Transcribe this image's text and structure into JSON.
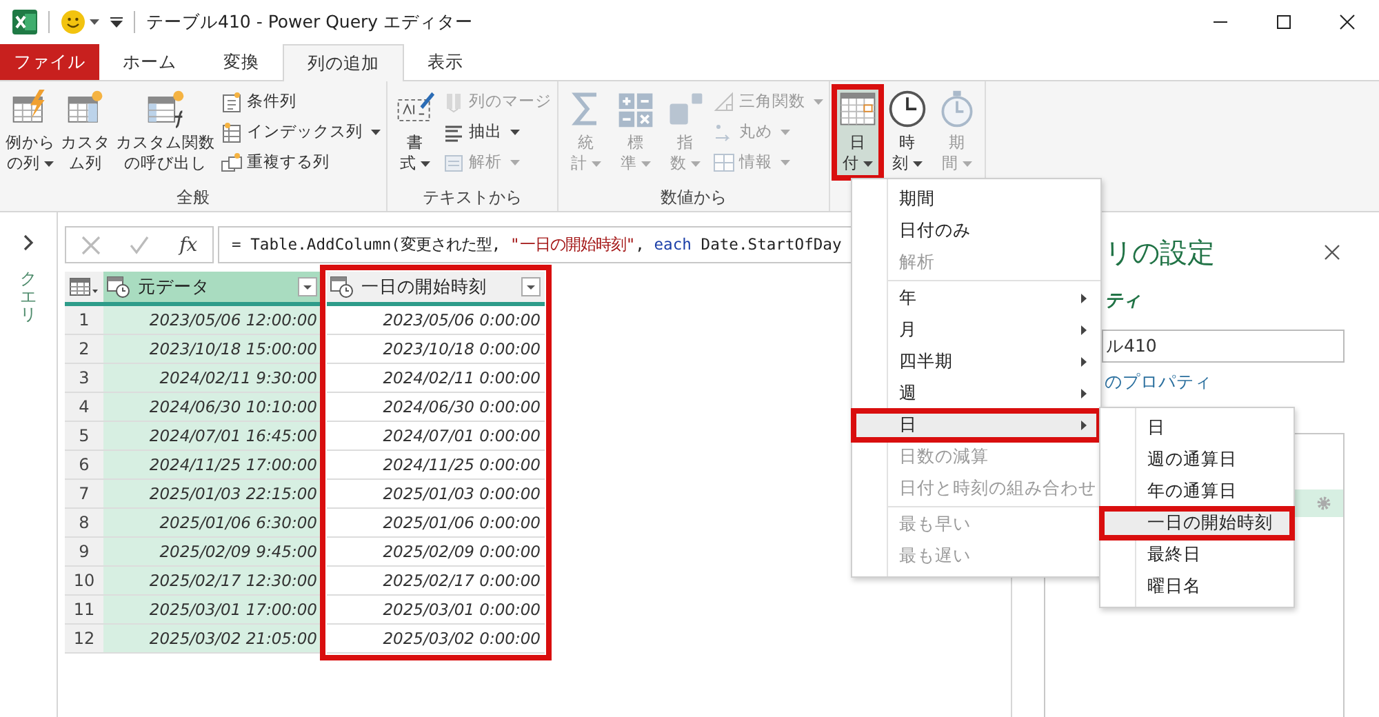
{
  "window": {
    "title": "テーブル410 - Power Query エディター"
  },
  "tabs": [
    {
      "label": "ファイル",
      "kind": "file",
      "selected": false
    },
    {
      "label": "ホーム",
      "kind": "tab",
      "selected": false
    },
    {
      "label": "変換",
      "kind": "tab",
      "selected": false
    },
    {
      "label": "列の追加",
      "kind": "tab",
      "selected": true
    },
    {
      "label": "表示",
      "kind": "tab",
      "selected": false
    }
  ],
  "ribbon": {
    "groups": [
      {
        "label": "全般",
        "items": [
          {
            "kind": "large",
            "lines": [
              "例から",
              "の列"
            ],
            "dropdown": true,
            "disabled": false,
            "highlighted": false
          },
          {
            "kind": "large",
            "lines": [
              "カスタ",
              "ム列"
            ],
            "dropdown": false,
            "disabled": false,
            "highlighted": false
          },
          {
            "kind": "large",
            "lines": [
              "カスタム関数",
              "の呼び出し"
            ],
            "dropdown": false,
            "disabled": false,
            "highlighted": false
          },
          {
            "kind": "stack",
            "entries": [
              {
                "label": "条件列",
                "dropdown": false,
                "disabled": false
              },
              {
                "label": "インデックス列",
                "dropdown": true,
                "disabled": false
              },
              {
                "label": "重複する列",
                "dropdown": false,
                "disabled": false
              }
            ]
          }
        ]
      },
      {
        "label": "テキストから",
        "items": [
          {
            "kind": "large",
            "lines": [
              "書",
              "式"
            ],
            "dropdown": true,
            "disabled": false,
            "highlighted": false
          },
          {
            "kind": "stack",
            "entries": [
              {
                "label": "列のマージ",
                "dropdown": false,
                "disabled": true
              },
              {
                "label": "抽出",
                "dropdown": true,
                "disabled": false
              },
              {
                "label": "解析",
                "dropdown": true,
                "disabled": true
              }
            ]
          }
        ]
      },
      {
        "label": "数値から",
        "items": [
          {
            "kind": "large",
            "lines": [
              "統",
              "計"
            ],
            "dropdown": true,
            "disabled": true,
            "highlighted": false
          },
          {
            "kind": "large",
            "lines": [
              "標",
              "準"
            ],
            "dropdown": true,
            "disabled": true,
            "highlighted": false
          },
          {
            "kind": "large",
            "lines": [
              "指",
              "数"
            ],
            "dropdown": true,
            "disabled": true,
            "highlighted": false
          },
          {
            "kind": "stack",
            "entries": [
              {
                "label": "三角関数",
                "dropdown": true,
                "disabled": true
              },
              {
                "label": "丸め",
                "dropdown": true,
                "disabled": true
              },
              {
                "label": "情報",
                "dropdown": true,
                "disabled": true
              }
            ]
          }
        ]
      },
      {
        "items": [
          {
            "kind": "large",
            "lines": [
              "日",
              "付"
            ],
            "dropdown": true,
            "disabled": false,
            "highlighted": true
          },
          {
            "kind": "large",
            "lines": [
              "時",
              "刻"
            ],
            "dropdown": true,
            "disabled": false,
            "highlighted": false
          },
          {
            "kind": "large",
            "lines": [
              "期",
              "間"
            ],
            "dropdown": true,
            "disabled": true,
            "highlighted": false
          }
        ]
      }
    ]
  },
  "left_pane": {
    "label": "クエリ"
  },
  "formula_bar": {
    "fx_label": "fx",
    "parts": [
      {
        "kind": "code",
        "text": "= Table.AddColumn(変更された型, "
      },
      {
        "kind": "string",
        "text": "\"一日の開始時刻\""
      },
      {
        "kind": "code",
        "text": ", "
      },
      {
        "kind": "keyword",
        "text": "each"
      },
      {
        "kind": "code",
        "text": " Date.StartOfDay"
      }
    ]
  },
  "table": {
    "columns": [
      {
        "name": "元データ",
        "selected": true,
        "highlighted": false
      },
      {
        "name": "一日の開始時刻",
        "selected": false,
        "highlighted": true
      }
    ],
    "rows": [
      {
        "number": "1",
        "cells": [
          "2023/05/06 12:00:00",
          "2023/05/06 0:00:00"
        ]
      },
      {
        "number": "2",
        "cells": [
          "2023/10/18 15:00:00",
          "2023/10/18 0:00:00"
        ]
      },
      {
        "number": "3",
        "cells": [
          "2024/02/11 9:30:00",
          "2024/02/11 0:00:00"
        ]
      },
      {
        "number": "4",
        "cells": [
          "2024/06/30 10:10:00",
          "2024/06/30 0:00:00"
        ]
      },
      {
        "number": "5",
        "cells": [
          "2024/07/01 16:45:00",
          "2024/07/01 0:00:00"
        ]
      },
      {
        "number": "6",
        "cells": [
          "2024/11/25 17:00:00",
          "2024/11/25 0:00:00"
        ]
      },
      {
        "number": "7",
        "cells": [
          "2025/01/03 22:15:00",
          "2025/01/03 0:00:00"
        ]
      },
      {
        "number": "8",
        "cells": [
          "2025/01/06 6:30:00",
          "2025/01/06 0:00:00"
        ]
      },
      {
        "number": "9",
        "cells": [
          "2025/02/09 9:45:00",
          "2025/02/09 0:00:00"
        ]
      },
      {
        "number": "10",
        "cells": [
          "2025/02/17 12:30:00",
          "2025/02/17 0:00:00"
        ]
      },
      {
        "number": "11",
        "cells": [
          "2025/03/01 17:00:00",
          "2025/03/01 0:00:00"
        ]
      },
      {
        "number": "12",
        "cells": [
          "2025/03/02 21:05:00",
          "2025/03/02 0:00:00"
        ]
      }
    ]
  },
  "settings_pane": {
    "title": "リの設定",
    "properties_heading": "ティ",
    "name_value": "ル410",
    "all_properties_link": "のプロパティ",
    "steps": [
      {
        "selected": true
      }
    ]
  },
  "menu": {
    "items": [
      {
        "kind": "item",
        "label": "期間",
        "disabled": false,
        "submenu": false,
        "highlighted": false
      },
      {
        "kind": "item",
        "label": "日付のみ",
        "disabled": false,
        "submenu": false,
        "highlighted": false
      },
      {
        "kind": "item",
        "label": "解析",
        "disabled": true,
        "submenu": false,
        "highlighted": false
      },
      {
        "kind": "separator"
      },
      {
        "kind": "item",
        "label": "年",
        "disabled": false,
        "submenu": true,
        "highlighted": false
      },
      {
        "kind": "item",
        "label": "月",
        "disabled": false,
        "submenu": true,
        "highlighted": false
      },
      {
        "kind": "item",
        "label": "四半期",
        "disabled": false,
        "submenu": true,
        "highlighted": false
      },
      {
        "kind": "item",
        "label": "週",
        "disabled": false,
        "submenu": true,
        "highlighted": false
      },
      {
        "kind": "item",
        "label": "日",
        "disabled": false,
        "submenu": true,
        "highlighted": true
      },
      {
        "kind": "item",
        "label": "日数の減算",
        "disabled": true,
        "submenu": false,
        "highlighted": false
      },
      {
        "kind": "item",
        "label": "日付と時刻の組み合わせ",
        "disabled": true,
        "submenu": false,
        "highlighted": false
      },
      {
        "kind": "separator"
      },
      {
        "kind": "item",
        "label": "最も早い",
        "disabled": true,
        "submenu": false,
        "highlighted": false
      },
      {
        "kind": "item",
        "label": "最も遅い",
        "disabled": true,
        "submenu": false,
        "highlighted": false
      }
    ]
  },
  "submenu": {
    "items": [
      {
        "label": "日",
        "highlighted": false
      },
      {
        "label": "週の通算日",
        "highlighted": false
      },
      {
        "label": "年の通算日",
        "highlighted": false
      },
      {
        "label": "一日の開始時刻",
        "highlighted": true
      },
      {
        "label": "最終日",
        "highlighted": false
      },
      {
        "label": "曜日名",
        "highlighted": false
      }
    ]
  }
}
